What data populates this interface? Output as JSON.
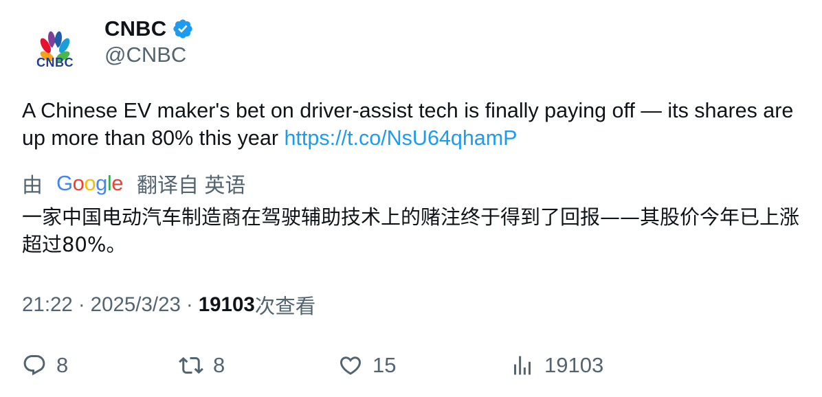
{
  "author": {
    "display_name": "CNBC",
    "handle": "@CNBC",
    "verified": true,
    "avatar_logo_text": "CNBC"
  },
  "tweet": {
    "text": "A Chinese EV maker's bet on driver-assist tech is finally paying off — its shares are up more than 80% this year ",
    "link": "https://t.co/NsU64qhamP"
  },
  "translation": {
    "prefix": "由",
    "provider": "Google",
    "suffix": "翻译自 英语",
    "text": "一家中国电动汽车制造商在驾驶辅助技术上的赌注终于得到了回报——其股价今年已上涨超过80%。"
  },
  "meta": {
    "time": "21:22",
    "separator": "·",
    "date": "2025/3/23",
    "views_count": "19103",
    "views_label": "次查看"
  },
  "actions": {
    "replies": "8",
    "retweets": "8",
    "likes": "15",
    "views": "19103"
  },
  "colors": {
    "link": "#1d9bf0",
    "secondary_text": "#536471",
    "verified_badge": "#1d9bf0"
  },
  "icons": {
    "verified": "verified-badge-icon",
    "reply": "reply-icon",
    "retweet": "retweet-icon",
    "like": "heart-icon",
    "views": "analytics-icon"
  }
}
